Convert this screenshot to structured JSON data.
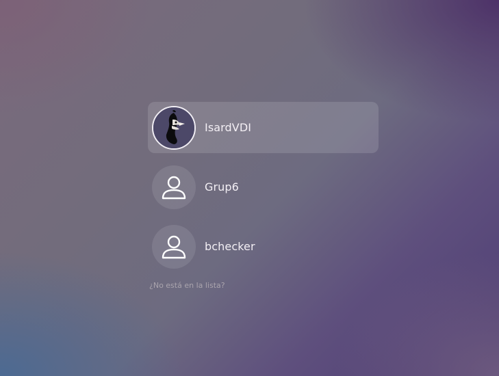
{
  "login": {
    "users": [
      {
        "name": "IsardVDI",
        "avatar": "isardvdi-logo-icon",
        "selected": true
      },
      {
        "name": "Grup6",
        "avatar": "default-user-icon",
        "selected": false
      },
      {
        "name": "bchecker",
        "avatar": "default-user-icon",
        "selected": false
      }
    ],
    "not_listed_link": "¿No está en la lista?"
  },
  "colors": {
    "selection_bg": "#ffffff21",
    "text": "#f3eff4",
    "muted_text": "#aaa4ad"
  }
}
